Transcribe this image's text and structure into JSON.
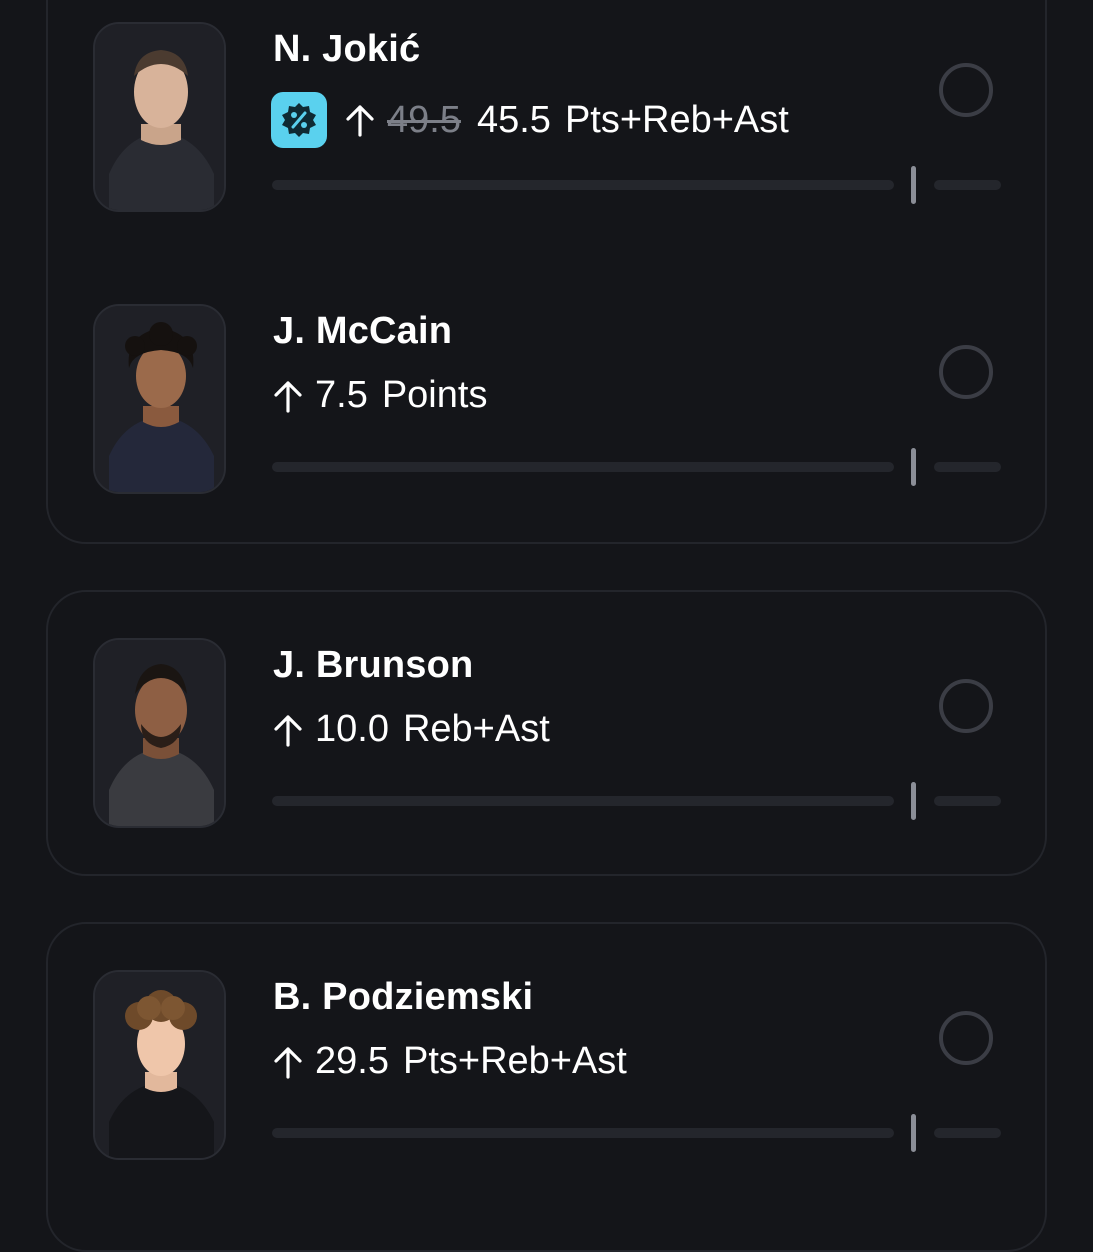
{
  "picks": [
    {
      "name": "N. Jokić",
      "promo_icon": "percent-badge-icon",
      "direction_icon": "arrow-up-icon",
      "old_value": "49.5",
      "value": "45.5",
      "stat": "Pts+Reb+Ast",
      "selected": false
    },
    {
      "name": "J. McCain",
      "direction_icon": "arrow-up-icon",
      "value": "7.5",
      "stat": "Points",
      "selected": false
    },
    {
      "name": "J. Brunson",
      "direction_icon": "arrow-up-icon",
      "value": "10.0",
      "stat": "Reb+Ast",
      "selected": false
    },
    {
      "name": "B. Podziemski",
      "direction_icon": "arrow-up-icon",
      "value": "29.5",
      "stat": "Pts+Reb+Ast",
      "selected": false
    }
  ],
  "colors": {
    "background": "#141519",
    "card_border": "#23252b",
    "promo_badge": "#5ad1ee",
    "muted_text": "#7c7f88"
  }
}
